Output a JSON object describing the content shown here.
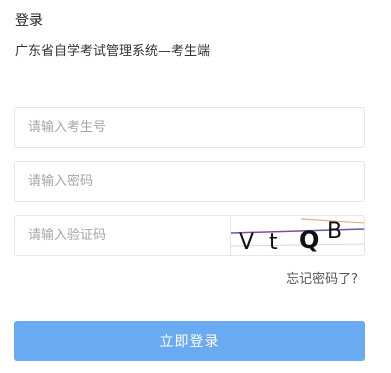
{
  "header": {
    "title": "登录",
    "subtitle": "广东省自学考试管理系统—考生端"
  },
  "form": {
    "student_id_placeholder": "请输入考生号",
    "password_placeholder": "请输入密码",
    "captcha_placeholder": "请输入验证码",
    "captcha_text": "VtQB",
    "forgot_password": "忘记密码了?",
    "submit_label": "立即登录"
  },
  "colors": {
    "primary_button": "#6aaaf0",
    "border": "#e6e6e6"
  }
}
